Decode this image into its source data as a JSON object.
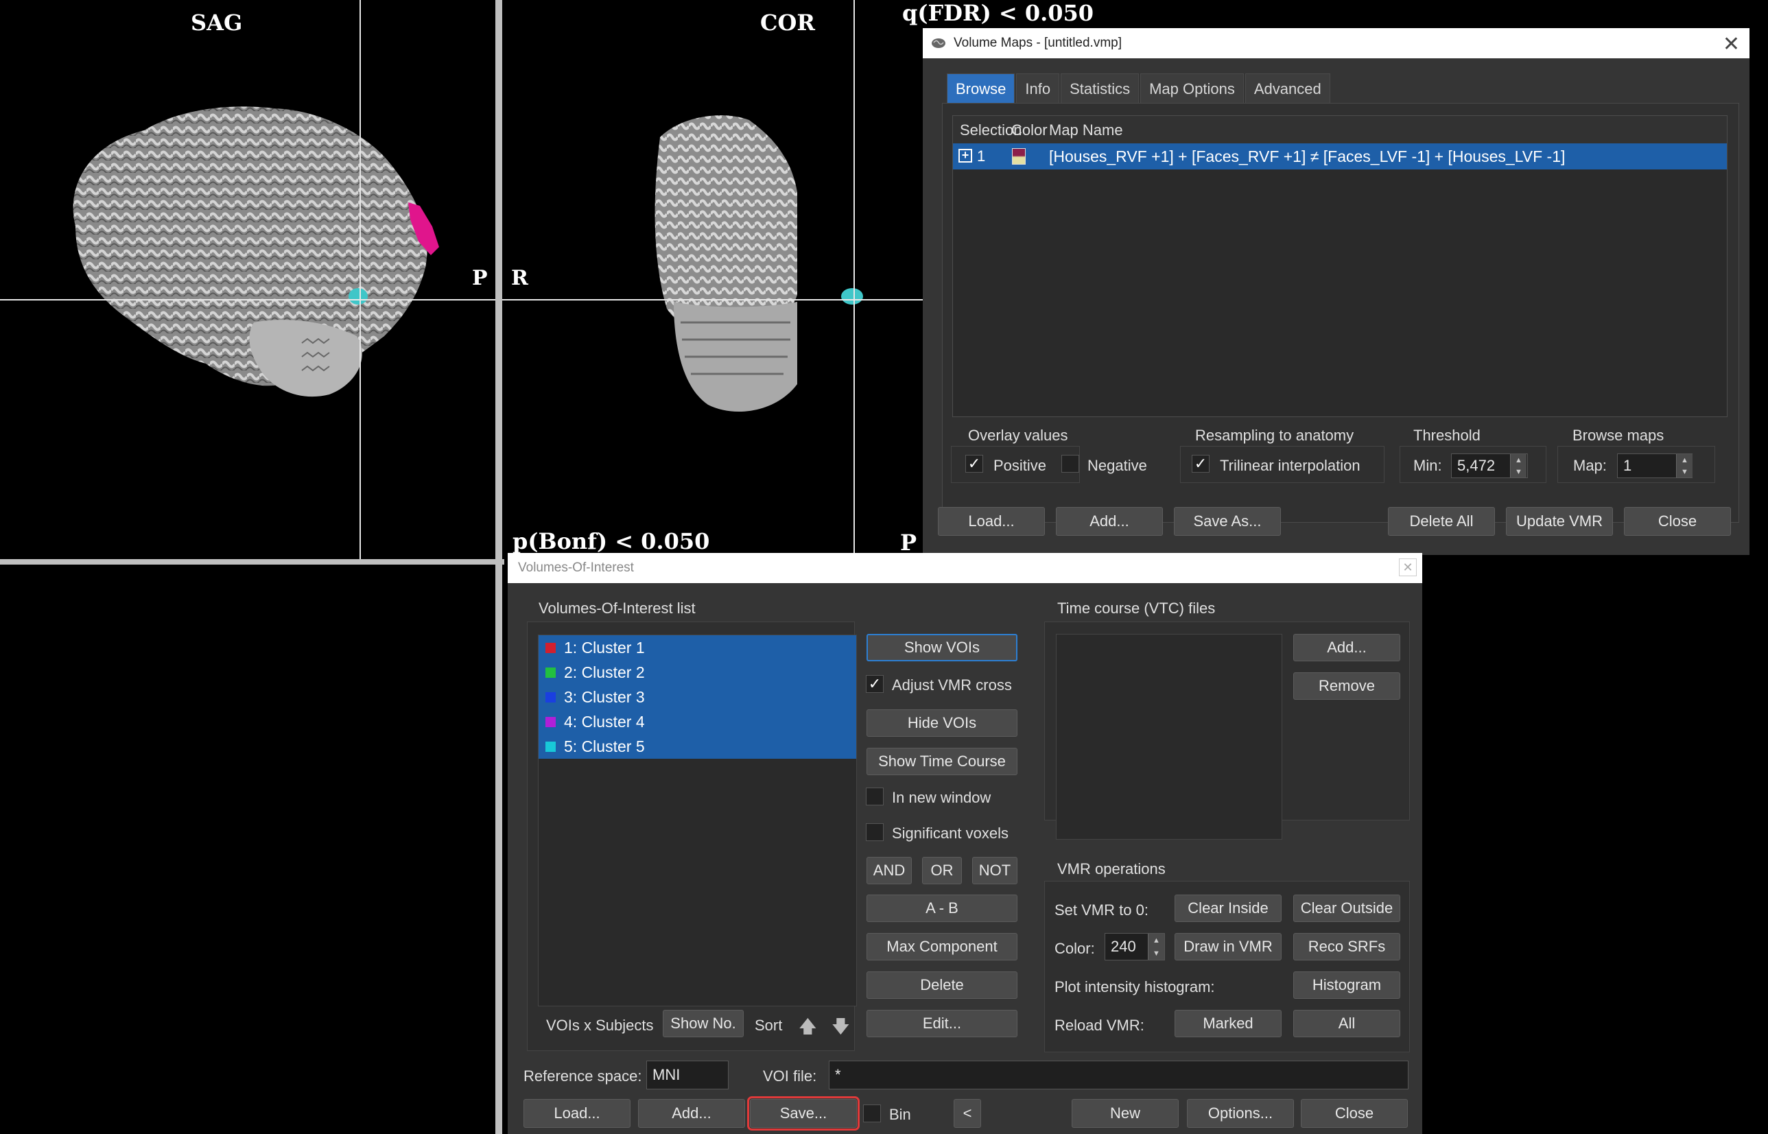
{
  "views": {
    "sag_label": "SAG",
    "cor_label": "COR",
    "orient_p": "P",
    "orient_r": "R",
    "orient_p2": "P",
    "fdr_label": "q(FDR) < 0.050",
    "bonf_label": "p(Bonf) < 0.050"
  },
  "volume_maps": {
    "title": "Volume Maps - [untitled.vmp]",
    "tabs": [
      "Browse",
      "Info",
      "Statistics",
      "Map Options",
      "Advanced"
    ],
    "active_tab": "Browse",
    "columns": [
      "Selection",
      "Color",
      "Map Name"
    ],
    "rows": [
      {
        "selection": "1",
        "map_name": "[Houses_RVF +1] + [Faces_RVF +1] ≠ [Faces_LVF -1] + [Houses_LVF -1]"
      }
    ],
    "overlay_values_label": "Overlay values",
    "positive_label": "Positive",
    "positive_checked": true,
    "negative_label": "Negative",
    "negative_checked": false,
    "resampling_label": "Resampling to anatomy",
    "trilinear_label": "Trilinear interpolation",
    "trilinear_checked": true,
    "threshold_label": "Threshold",
    "min_label": "Min:",
    "min_value": "5,472",
    "browse_maps_label": "Browse maps",
    "map_label": "Map:",
    "map_value": "1",
    "buttons": {
      "load": "Load...",
      "add": "Add...",
      "save_as": "Save As...",
      "delete_all": "Delete All",
      "update_vmr": "Update VMR",
      "close": "Close"
    }
  },
  "voi": {
    "title": "Volumes-Of-Interest",
    "list_label": "Volumes-Of-Interest list",
    "items": [
      {
        "label": "1: Cluster 1",
        "color": "#d1202f"
      },
      {
        "label": "2: Cluster 2",
        "color": "#22c040"
      },
      {
        "label": "3: Cluster 3",
        "color": "#1a3fe0"
      },
      {
        "label": "4: Cluster 4",
        "color": "#b020d8"
      },
      {
        "label": "5: Cluster 5",
        "color": "#18c8d8"
      }
    ],
    "show_vois": "Show VOIs",
    "adjust_vmr_cross": "Adjust VMR cross",
    "adjust_checked": true,
    "hide_vois": "Hide VOIs",
    "show_time_course": "Show Time Course",
    "in_new_window": "In new window",
    "significant_voxels": "Significant voxels",
    "and": "AND",
    "or": "OR",
    "not": "NOT",
    "a_minus_b": "A - B",
    "max_component": "Max Component",
    "delete": "Delete",
    "edit": "Edit...",
    "vois_x_subjects": "VOIs x Subjects",
    "show_no": "Show No.",
    "sort": "Sort",
    "vtc_label": "Time course (VTC) files",
    "vtc_add": "Add...",
    "vtc_remove": "Remove",
    "vmr_ops_label": "VMR operations",
    "set_vmr_to_0": "Set VMR to 0:",
    "clear_inside": "Clear Inside",
    "clear_outside": "Clear Outside",
    "color_label": "Color:",
    "color_value": "240",
    "draw_in_vmr": "Draw in VMR",
    "reco_srfs": "Reco SRFs",
    "plot_hist_label": "Plot intensity histogram:",
    "histogram": "Histogram",
    "reload_vmr": "Reload VMR:",
    "marked": "Marked",
    "all": "All",
    "ref_space_label": "Reference space:",
    "ref_space_value": "MNI",
    "voi_file_label": "VOI file:",
    "voi_file_value": "*",
    "load": "Load...",
    "add": "Add...",
    "save": "Save...",
    "bin": "Bin",
    "prev": "<",
    "new": "New",
    "options": "Options...",
    "close": "Close"
  }
}
